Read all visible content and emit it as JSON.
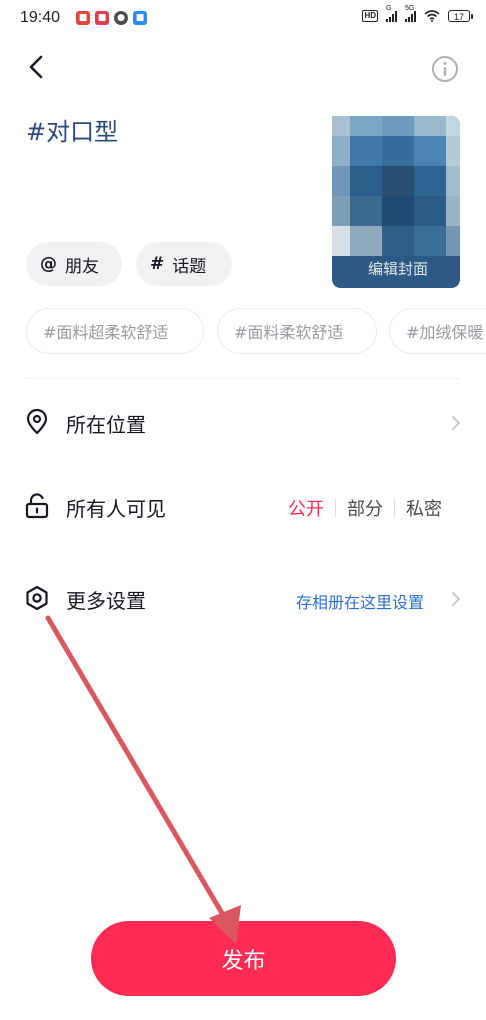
{
  "status_bar": {
    "time": "19:40",
    "network": "5G",
    "signal_label": "G",
    "hd_label": "HD",
    "battery": "17"
  },
  "header": {
    "back_icon": "chevron-left-icon",
    "info_icon": "info-icon"
  },
  "post": {
    "title": "#对口型",
    "cover_label": "编辑封面"
  },
  "chips": {
    "friends_symbol": "@",
    "friends": "朋友",
    "topic_symbol": "#",
    "topic": "话题"
  },
  "suggested_tags": [
    "#面料超柔软舒适",
    "#面料柔软舒适",
    "#加绒保暖"
  ],
  "settings": {
    "location_label": "所在位置",
    "visibility_label": "所有人可见",
    "visibility_options": [
      "公开",
      "部分",
      "私密"
    ],
    "visibility_selected": "公开",
    "more_label": "更多设置",
    "more_link": "存相册在这里设置"
  },
  "publish_button": "发布",
  "colors": {
    "accent": "#fe2c55",
    "link": "#2f6fd1",
    "title": "#2e4a7a",
    "annotation_arrow": "#d9575e"
  }
}
